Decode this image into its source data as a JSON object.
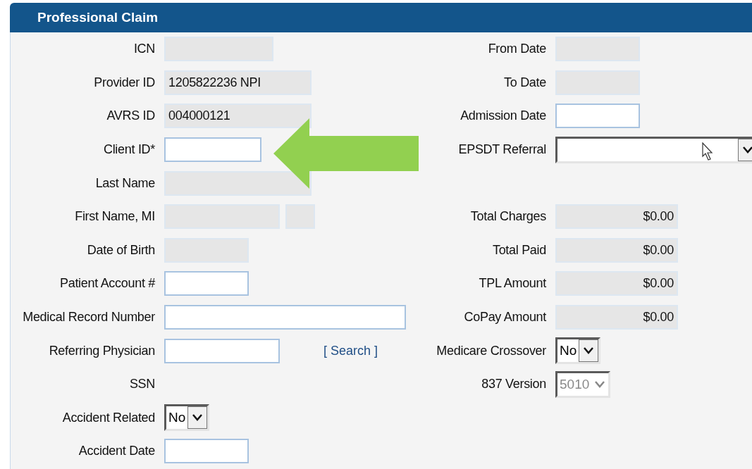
{
  "panel": {
    "title": "Professional Claim"
  },
  "left_fields": [
    {
      "label": "ICN",
      "kind": "text",
      "readonly": true
    },
    {
      "label": "Provider ID",
      "kind": "text",
      "readonly": true,
      "value": "1205822236 NPI"
    },
    {
      "label": "AVRS ID",
      "kind": "text",
      "readonly": true,
      "value": "004000121"
    },
    {
      "label": "Client ID*",
      "kind": "text",
      "readonly": false
    },
    {
      "label": "Last Name",
      "kind": "text",
      "readonly": true
    },
    {
      "label": "First Name, MI",
      "kind": "pair",
      "readonly": true
    },
    {
      "label": "Date of Birth",
      "kind": "text",
      "readonly": true
    },
    {
      "label": "Patient Account #",
      "kind": "text",
      "readonly": false
    },
    {
      "label": "Medical Record Number",
      "kind": "text",
      "readonly": false
    },
    {
      "label": "Referring Physician",
      "kind": "text",
      "readonly": false,
      "link": "[ Search ]"
    },
    {
      "label": "SSN",
      "kind": "label"
    },
    {
      "label": "Accident Related",
      "kind": "select",
      "value": "No",
      "disabled": false
    },
    {
      "label": "Accident Date",
      "kind": "text",
      "readonly": false
    }
  ],
  "right_sections": [
    {
      "fields": [
        {
          "label": "From Date",
          "kind": "text",
          "readonly": true
        },
        {
          "label": "To Date",
          "kind": "text",
          "readonly": true
        },
        {
          "label": "Admission Date",
          "kind": "text",
          "readonly": false
        },
        {
          "label": "EPSDT Referral",
          "kind": "select",
          "disabled": false
        }
      ]
    },
    {
      "fields": [
        {
          "label": "Total Charges",
          "kind": "money",
          "readonly": true,
          "value": "$0.00"
        },
        {
          "label": "Total Paid",
          "kind": "money",
          "readonly": true,
          "value": "$0.00"
        },
        {
          "label": "TPL Amount",
          "kind": "money",
          "readonly": true,
          "value": "$0.00"
        },
        {
          "label": "CoPay Amount",
          "kind": "money",
          "readonly": true,
          "value": "$0.00"
        },
        {
          "label": "Medicare Crossover",
          "kind": "select",
          "value": "No",
          "disabled": false
        },
        {
          "label": "837 Version",
          "kind": "select",
          "value": "5010",
          "disabled": true
        }
      ]
    }
  ]
}
